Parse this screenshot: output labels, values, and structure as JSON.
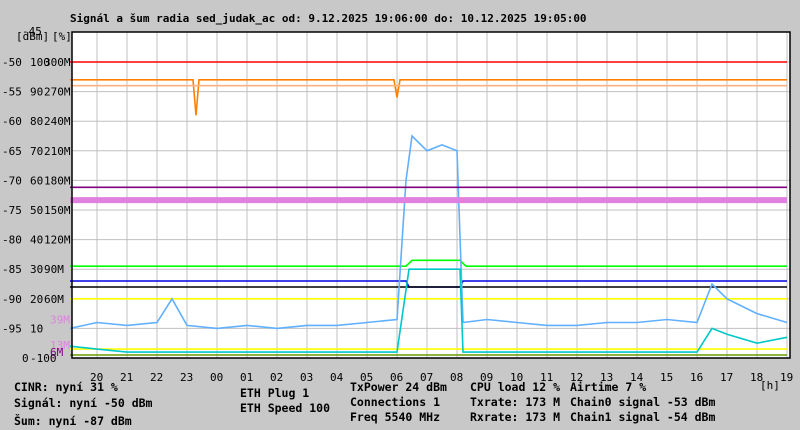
{
  "chart_data": {
    "type": "line",
    "title": "Signál a šum radia sed_judak_ac od: 9.12.2025 19:06:00 do: 10.12.2025 19:05:00",
    "axis_units": {
      "dbm": "[dBm]",
      "pct": "[%]",
      "x": "[h]"
    },
    "ylim_dbm": [
      -100,
      -45
    ],
    "y_ticks_dbm": [
      -50,
      -55,
      -60,
      -65,
      -70,
      -75,
      -80,
      -85,
      -90,
      -95,
      -100
    ],
    "y_top_label": "-45",
    "y_ticks_pct": [
      "100",
      "90",
      "80",
      "70",
      "60",
      "50",
      "40",
      "30",
      "20",
      "10",
      "0"
    ],
    "y_ticks_rate": [
      "300M",
      "270M",
      "240M",
      "210M",
      "180M",
      "150M",
      "120M",
      "90M",
      "60M"
    ],
    "extra_rate_labels": [
      {
        "text": "39M",
        "value_m": 39,
        "color": "#e080e0"
      },
      {
        "text": "13M",
        "value_m": 13,
        "color": "#e080e0"
      },
      {
        "text": "6M",
        "value_m": 6,
        "color": "#800080"
      }
    ],
    "x_note": "x values are hours after 19:00 on 9.12.2025",
    "x_ticks": [
      "20",
      "21",
      "22",
      "23",
      "00",
      "01",
      "02",
      "03",
      "04",
      "05",
      "06",
      "07",
      "08",
      "09",
      "10",
      "11",
      "12",
      "13",
      "14",
      "15",
      "16",
      "17",
      "18",
      "19"
    ],
    "grid": true,
    "series": [
      {
        "name": "Signál",
        "unit": "dBm",
        "color": "#ff0000",
        "points": [
          [
            0.1,
            -50
          ],
          [
            6,
            -50
          ],
          [
            12,
            -50
          ],
          [
            18,
            -50
          ],
          [
            24,
            -50
          ]
        ]
      },
      {
        "name": "Chain0 signal",
        "unit": "dBm",
        "color": "#ff8000",
        "points": [
          [
            0.1,
            -53
          ],
          [
            4.2,
            -53
          ],
          [
            4.3,
            -59
          ],
          [
            4.4,
            -53
          ],
          [
            10.9,
            -53
          ],
          [
            11,
            -56
          ],
          [
            11.1,
            -53
          ],
          [
            24,
            -53
          ]
        ]
      },
      {
        "name": "Chain1 signal",
        "unit": "dBm",
        "color": "#ffb080",
        "points": [
          [
            0.1,
            -54
          ],
          [
            24,
            -54
          ]
        ]
      },
      {
        "name": "Šum",
        "unit": "dBm",
        "color": "#0000e0",
        "points": [
          [
            0.1,
            -87
          ],
          [
            11.3,
            -87
          ],
          [
            11.4,
            -88
          ],
          [
            13.1,
            -88
          ],
          [
            13.2,
            -87
          ],
          [
            24,
            -87
          ]
        ]
      },
      {
        "name": "CINR",
        "unit": "%",
        "color": "#00ff00",
        "points": [
          [
            0.1,
            31
          ],
          [
            11.3,
            31
          ],
          [
            11.5,
            33
          ],
          [
            13.1,
            33
          ],
          [
            13.3,
            31
          ],
          [
            24,
            31
          ]
        ]
      },
      {
        "name": "TxPower",
        "unit": "%",
        "color": "#000000",
        "points": [
          [
            0.1,
            24
          ],
          [
            24,
            24
          ]
        ]
      },
      {
        "name": "ETH Speed",
        "unit": "%",
        "color": "#ffff00",
        "points": [
          [
            0.1,
            20
          ],
          [
            24,
            20
          ]
        ]
      },
      {
        "name": "ETH Plug",
        "unit": "%",
        "color": "#ffff00",
        "points": [
          [
            0.1,
            3
          ],
          [
            24,
            3
          ]
        ]
      },
      {
        "name": "Connections",
        "unit": "%",
        "color": "#6a9a00",
        "points": [
          [
            0.1,
            1
          ],
          [
            24,
            1
          ]
        ]
      },
      {
        "name": "CPU load",
        "unit": "%",
        "color": "#60b0ff",
        "points": [
          [
            0.1,
            10
          ],
          [
            1,
            12
          ],
          [
            2,
            11
          ],
          [
            3,
            12
          ],
          [
            3.5,
            20
          ],
          [
            4,
            11
          ],
          [
            5,
            10
          ],
          [
            6,
            11
          ],
          [
            7,
            10
          ],
          [
            8,
            11
          ],
          [
            9,
            11
          ],
          [
            10,
            12
          ],
          [
            11,
            13
          ],
          [
            11.3,
            60
          ],
          [
            11.5,
            75
          ],
          [
            12,
            70
          ],
          [
            12.5,
            72
          ],
          [
            13,
            70
          ],
          [
            13.2,
            12
          ],
          [
            14,
            13
          ],
          [
            15,
            12
          ],
          [
            16,
            11
          ],
          [
            17,
            11
          ],
          [
            18,
            12
          ],
          [
            19,
            12
          ],
          [
            20,
            13
          ],
          [
            21,
            12
          ],
          [
            21.5,
            25
          ],
          [
            22,
            20
          ],
          [
            23,
            15
          ],
          [
            24,
            12
          ]
        ]
      },
      {
        "name": "Airtime",
        "unit": "%",
        "color": "#00c8c8",
        "points": [
          [
            0.1,
            4
          ],
          [
            1,
            3
          ],
          [
            2,
            2
          ],
          [
            3,
            2
          ],
          [
            4,
            2
          ],
          [
            5,
            2
          ],
          [
            6,
            2
          ],
          [
            7,
            2
          ],
          [
            8,
            2
          ],
          [
            9,
            2
          ],
          [
            10,
            2
          ],
          [
            11,
            2
          ],
          [
            11.4,
            30
          ],
          [
            13.1,
            30
          ],
          [
            13.2,
            2
          ],
          [
            14,
            2
          ],
          [
            16,
            2
          ],
          [
            18,
            2
          ],
          [
            20,
            2
          ],
          [
            21,
            2
          ],
          [
            21.5,
            10
          ],
          [
            22,
            8
          ],
          [
            23,
            5
          ],
          [
            24,
            7
          ]
        ]
      },
      {
        "name": "Txrate",
        "unit": "M",
        "color": "#e080e0",
        "points": [
          [
            0.1,
            160
          ],
          [
            4,
            160
          ],
          [
            8,
            160
          ],
          [
            12,
            160
          ],
          [
            16,
            160
          ],
          [
            20,
            160
          ],
          [
            24,
            160
          ]
        ]
      },
      {
        "name": "Rxrate",
        "unit": "M",
        "color": "#800080",
        "points": [
          [
            0.1,
            173
          ],
          [
            24,
            173
          ]
        ]
      }
    ],
    "legend": {
      "cinr": {
        "text": "CINR: nyní 31 %",
        "color": "#00ff00"
      },
      "signal": {
        "text": "Signál: nyní -50 dBm",
        "color": "#ff0000"
      },
      "noise": {
        "text": "Šum: nyní -87 dBm",
        "color": "#0000e0"
      },
      "eth_plug": {
        "text": "ETH Plug 1",
        "color": "#ffff00"
      },
      "eth_speed": {
        "text": "ETH Speed 100",
        "color": "#ffff00"
      },
      "txpower": {
        "text": "TxPower 24 dBm",
        "color": "#000000"
      },
      "connections": {
        "text": "Connections 1",
        "color": "#6a9a00"
      },
      "freq": {
        "text": "Freq 5540 MHz",
        "color": "#c04070"
      },
      "cpu": {
        "text": "CPU load 12 %",
        "color": "#60b0ff"
      },
      "txrate": {
        "text": "Txrate: 173 M",
        "color": "#e080e0"
      },
      "rxrate": {
        "text": "Rxrate: 173 M",
        "color": "#800080"
      },
      "airtime": {
        "text": "Airtime 7 %",
        "color": "#00c8c8"
      },
      "chain0": {
        "text": "Chain0 signal -53 dBm",
        "color": "#ff8000"
      },
      "chain1": {
        "text": "Chain1 signal -54 dBm",
        "color": "#ffb080"
      }
    }
  }
}
